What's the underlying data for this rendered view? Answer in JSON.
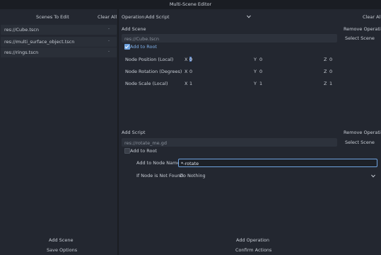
{
  "window": {
    "title": "Multi-Scene Editor"
  },
  "left": {
    "header": "Scenes To Edit",
    "clear_all": "Clear All",
    "scenes": [
      {
        "path": "res://Cube.tscn",
        "remove_glyph": "-"
      },
      {
        "path": "res://multi_surface_object.tscn",
        "remove_glyph": "-"
      },
      {
        "path": "res://rings.tscn",
        "remove_glyph": "-"
      }
    ],
    "add_scene": "Add Scene",
    "save_options": "Save Options"
  },
  "right": {
    "operation_label": "Operation:",
    "operation_value": "Add Script",
    "clear_all": "Clear All",
    "add_scene": {
      "title": "Add Scene",
      "remove": "Remove Operation",
      "scene_path": "res://Cube.tscn",
      "select": "Select Scene",
      "add_to_root": "Add to Root",
      "add_to_root_checked": true,
      "position": {
        "label": "Node Position (Local)",
        "x": "0",
        "y": "0",
        "z": "0"
      },
      "rotation": {
        "label": "Node Rotation (Degrees)",
        "x": "0",
        "y": "0",
        "z": "0"
      },
      "scale": {
        "label": "Node Scale (Local)",
        "x": "1",
        "y": "1",
        "z": "1"
      },
      "axis_x": "X",
      "axis_y": "Y",
      "axis_z": "Z"
    },
    "add_script": {
      "title": "Add Script",
      "remove": "Remove Operation",
      "script_path": "res://rotate_me.gd",
      "select": "Select Scene",
      "add_to_root": "Add to Root",
      "add_to_root_checked": false,
      "node_named_label": "Add to Node Named:",
      "node_named_value": "*-rotate",
      "not_found_label": "If Node is Not Found:",
      "not_found_value": "Do Nothing"
    },
    "add_operation": "Add Operation",
    "confirm_actions": "Confirm Actions"
  }
}
